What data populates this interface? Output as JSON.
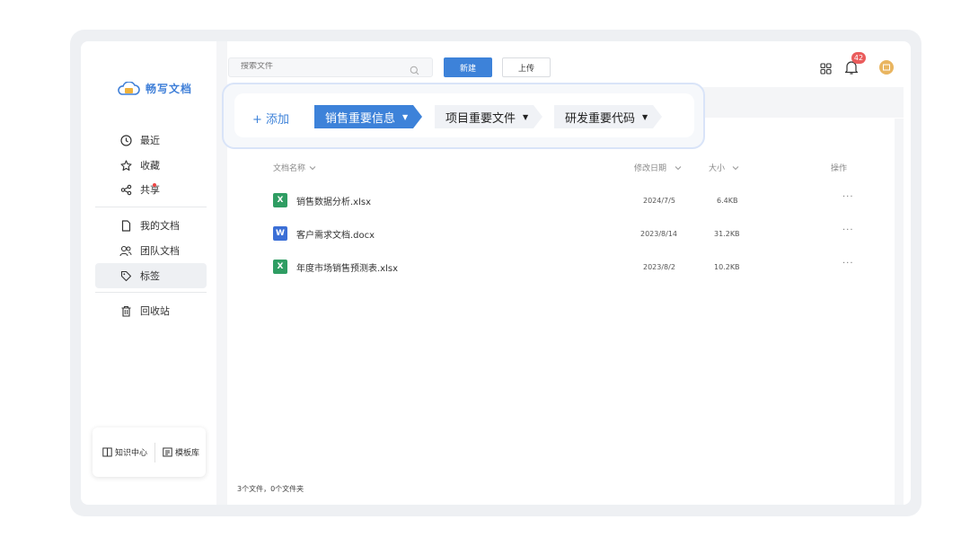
{
  "app": {
    "name": "畅写文档"
  },
  "sidebar": {
    "items": [
      {
        "label": "最近",
        "icon": "clock-icon"
      },
      {
        "label": "收藏",
        "icon": "star-icon"
      },
      {
        "label": "共享",
        "icon": "share-icon"
      },
      {
        "label": "我的文档",
        "icon": "document-icon"
      },
      {
        "label": "团队文档",
        "icon": "team-icon"
      },
      {
        "label": "标签",
        "icon": "tag-icon"
      },
      {
        "label": "回收站",
        "icon": "trash-icon"
      }
    ],
    "active_item": "标签",
    "bottom": {
      "knowledge": "知识中心",
      "templates": "模板库"
    }
  },
  "toolbar": {
    "search_placeholder": "搜索文件",
    "new_label": "新建",
    "upload_label": "上传",
    "notification_count": "42"
  },
  "tags": {
    "add_label": "+ 添加",
    "items": [
      {
        "label": "销售重要信息",
        "active": true
      },
      {
        "label": "项目重要文件",
        "active": false
      },
      {
        "label": "研发重要代码",
        "active": false
      }
    ]
  },
  "table": {
    "headers": {
      "name": "文档名称",
      "modified": "修改日期",
      "size": "大小",
      "actions": "操作"
    },
    "rows": [
      {
        "name": "销售数据分析.xlsx",
        "type": "xlsx",
        "date": "2024/7/5",
        "size": "6.4KB",
        "more": "···"
      },
      {
        "name": "客户需求文档.docx",
        "type": "docx",
        "date": "2023/8/14",
        "size": "31.2KB",
        "more": "···"
      },
      {
        "name": "年度市场销售预测表.xlsx",
        "type": "xlsx",
        "date": "2023/8/2",
        "size": "10.2KB",
        "more": "···"
      }
    ],
    "footer": "3个文件，0个文件夹"
  },
  "colors": {
    "accent": "#3d82d9",
    "badge": "#ea5c5c",
    "xlsx": "#2f9d63",
    "docx": "#3b6fd6"
  }
}
